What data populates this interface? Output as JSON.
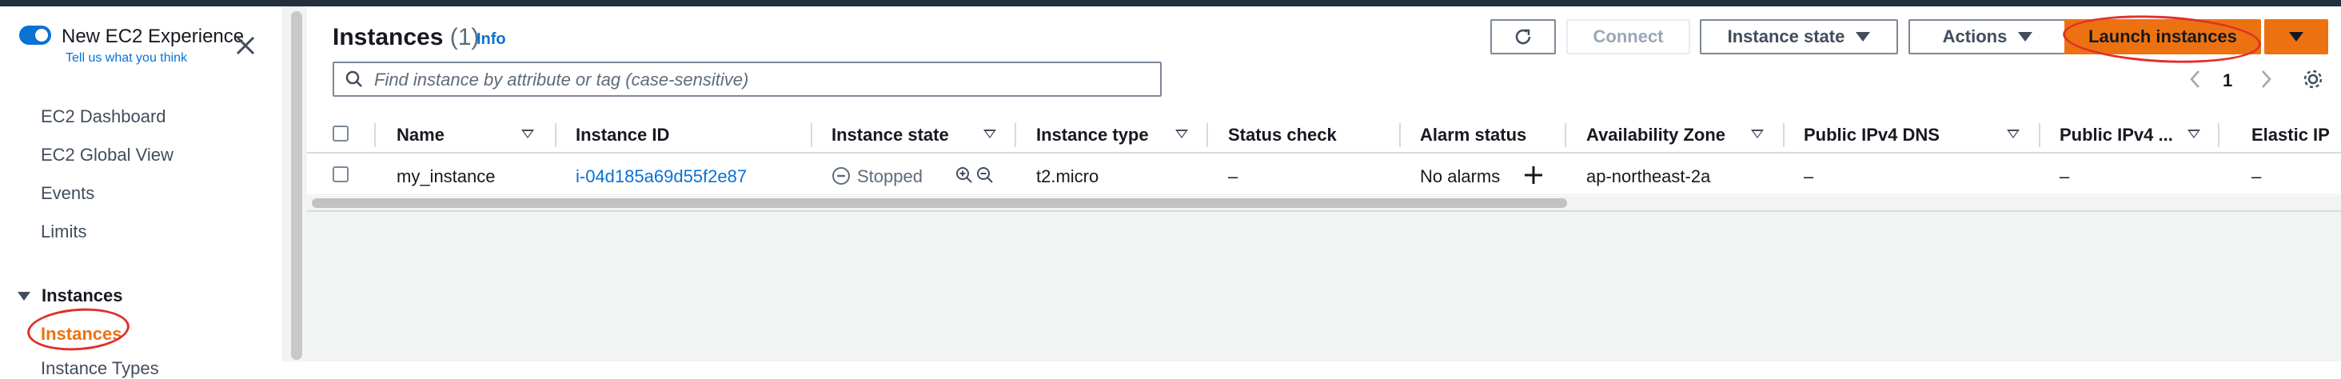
{
  "sidebar": {
    "experience_title": "New EC2 Experience",
    "experience_link": "Tell us what you think",
    "items": [
      "EC2 Dashboard",
      "EC2 Global View",
      "Events",
      "Limits"
    ],
    "section": "Instances",
    "active_item": "Instances",
    "cut_item": "Instance Types"
  },
  "header": {
    "title": "Instances",
    "count": "(1)",
    "info": "Info"
  },
  "toolbar": {
    "connect": "Connect",
    "instance_state": "Instance state",
    "actions": "Actions",
    "launch": "Launch instances"
  },
  "search": {
    "placeholder": "Find instance by attribute or tag (case-sensitive)"
  },
  "pagination": {
    "current_page": "1"
  },
  "table": {
    "columns": [
      "Name",
      "Instance ID",
      "Instance state",
      "Instance type",
      "Status check",
      "Alarm status",
      "Availability Zone",
      "Public IPv4 DNS",
      "Public IPv4 ...",
      "Elastic IP"
    ],
    "rows": [
      {
        "name": "my_instance",
        "instance_id": "i-04d185a69d55f2e87",
        "state": "Stopped",
        "type": "t2.micro",
        "status_check": "–",
        "alarm_status": "No alarms",
        "az": "ap-northeast-2a",
        "dns": "–",
        "ipv4": "–",
        "elastic_ip": "–"
      }
    ]
  },
  "colors": {
    "accent": "#0972d3",
    "primary_button": "#ec7211",
    "annotation": "#e0302a",
    "topbar": "#232f3e"
  }
}
